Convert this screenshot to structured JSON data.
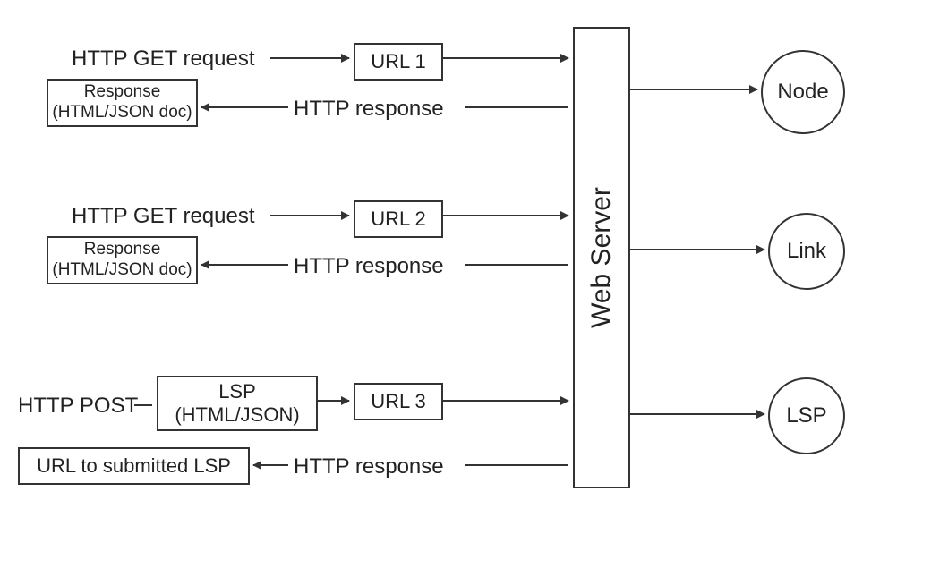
{
  "labels": {
    "get1": "HTTP GET request",
    "get2": "HTTP GET request",
    "post": "HTTP POST",
    "resp1": "Response\n(HTML/JSON doc)",
    "resp2": "Response\n(HTML/JSON doc)",
    "lspbody": "LSP\n(HTML/JSON)",
    "url1": "URL 1",
    "url2": "URL 2",
    "url3": "URL 3",
    "httpresp1": "HTTP response",
    "httpresp2": "HTTP response",
    "httpresp3": "HTTP response",
    "urlToLsp": "URL to submitted LSP",
    "webserver": "Web Server",
    "node": "Node",
    "link": "Link",
    "lsp": "LSP"
  }
}
